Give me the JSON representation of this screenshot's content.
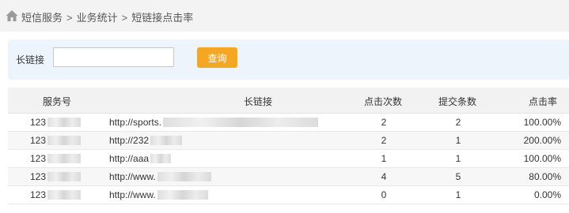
{
  "breadcrumb": {
    "items": [
      "短信服务",
      "业务统计",
      "短链接点击率"
    ],
    "separator": ">"
  },
  "filter": {
    "label": "长链接",
    "input_value": "",
    "query_button": "查询"
  },
  "table": {
    "headers": {
      "service": "服务号",
      "link": "长链接",
      "clicks": "点击次数",
      "submits": "提交条数",
      "rate": "点击率"
    },
    "rows": [
      {
        "service": "123",
        "link": "http://sports.",
        "clicks": "2",
        "submits": "2",
        "rate": "100.00%"
      },
      {
        "service": "123",
        "link": "http://232",
        "clicks": "2",
        "submits": "1",
        "rate": "200.00%"
      },
      {
        "service": "123",
        "link": "http://aaa",
        "clicks": "1",
        "submits": "1",
        "rate": "100.00%"
      },
      {
        "service": "123",
        "link": "http://www.",
        "clicks": "4",
        "submits": "5",
        "rate": "80.00%"
      },
      {
        "service": "123",
        "link": "http://www.",
        "clicks": "0",
        "submits": "1",
        "rate": "0.00%"
      }
    ]
  },
  "colors": {
    "accent": "#f5a623",
    "panel": "#eef4fb",
    "header_bg": "#f2f2f2"
  }
}
